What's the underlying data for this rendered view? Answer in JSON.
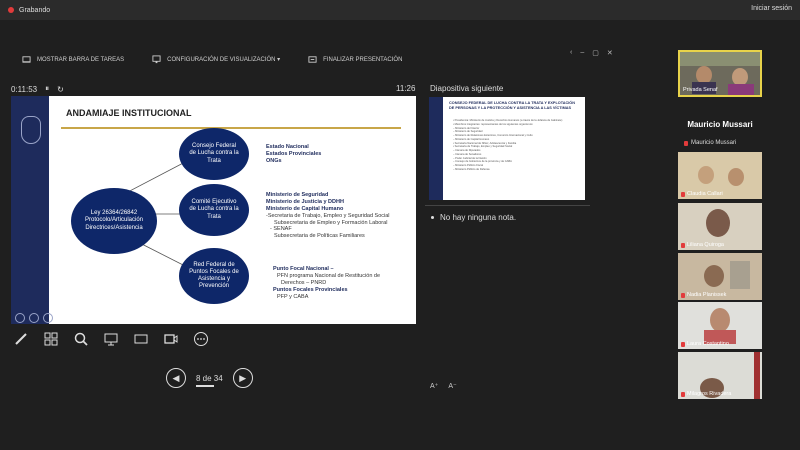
{
  "topbar": {
    "recording_label": "Grabando",
    "signin_label": "Iniciar sesión"
  },
  "toolbar": {
    "taskbar_label": "MOSTRAR BARRA DE TAREAS",
    "display_settings_label": "CONFIGURACIÓN DE VISUALIZACIÓN ▾",
    "end_presentation_label": "FINALIZAR PRESENTACIÓN"
  },
  "window_controls": {
    "back": "‹",
    "minimize": "–",
    "maximize": "▢",
    "close": "✕"
  },
  "timer": {
    "elapsed": "0:11:53",
    "pause": "⏸",
    "reset": "↻"
  },
  "clock": "11:26",
  "next_slide_label": "Diapositiva siguiente",
  "slide": {
    "title": "ANDAMIAJE INSTITUCIONAL",
    "center_node": "Ley 26364/26842 Protocolo/Articulación Directrices/Asistencia",
    "node_top": "Consejo Federal de Lucha contra la Trata",
    "node_mid": "Comité Ejecutivo de Lucha contra la Trata",
    "node_bottom": "Red Federal de Puntos Focales de Asistencia y Prevención",
    "group1": [
      "Estado Nacional",
      "Estados Provinciales",
      "ONGs"
    ],
    "group2_bold": [
      "Ministerio de Seguridad",
      "Ministerio de Justicia y DDHH",
      "Ministerio de Capital Humano"
    ],
    "group2_sub": [
      "-Secretaria de Trabajo, Empleo y Seguridad Social",
      "Subsecretaria de Empleo y Formación Laboral",
      "- SENAF",
      "Subsecretaria de Políticas Familiares"
    ],
    "group3_bold1": "Punto Focal Nacional –",
    "group3_sub1": [
      "PFN programa Nacional de Restitución de",
      "Derechos – PNRD"
    ],
    "group3_bold2": "Puntos Focales Provinciales",
    "group3_sub2": [
      "PFP y CABA"
    ]
  },
  "next_slide": {
    "title": "CONSEJO FEDERAL DE LUCHA CONTRA LA TRATA Y EXPLOTACIÓN DE PERSONAS Y LA PROTECCIÓN Y ASISTENCIA A LAS VÍCTIMAS",
    "lines": [
      "• Presidencia: Ministerio de Justicia y Derechos Humanos (a través de la Jefatura de Gabinete)",
      "• Miembros integrantes: representantes de los siguientes organismos:",
      "  – Ministerio del Interior",
      "  – Ministerio de Seguridad",
      "  – Ministerio de Relaciones Exteriores, Comercio Internacional y Culto",
      "  – Ministerio de Capital Humano",
      "  • Secretaría Nacional de Niñez, Adolescencia y Familia",
      "  • Secretaría de Trabajo, Empleo y Seguridad Social",
      "  – Cámara de Diputados",
      "  – Cámara de Senadores",
      "  – Poder Judicial de la Nación",
      "  – Consejo de Gobiernos de la provincia y de CABA",
      "  – Ministerio Público Fiscal",
      "  – Ministerio Público de Defensa"
    ]
  },
  "notes_text": "No hay ninguna nota.",
  "font_buttons": {
    "increase": "A⁺",
    "decrease": "A⁻"
  },
  "slide_nav": {
    "page": "8 de 34",
    "prev": "◀",
    "next": "▶"
  },
  "participants": {
    "speaker_name": "Mauricio Mussari",
    "speaker_sub": "Mauricio Mussari",
    "thumbs": [
      "Privada Senaf",
      "Claudia Callari",
      "Liliana Quiroga",
      "Nadia Planissek",
      "Laura Costantino",
      "Milagros Rivadera"
    ]
  }
}
